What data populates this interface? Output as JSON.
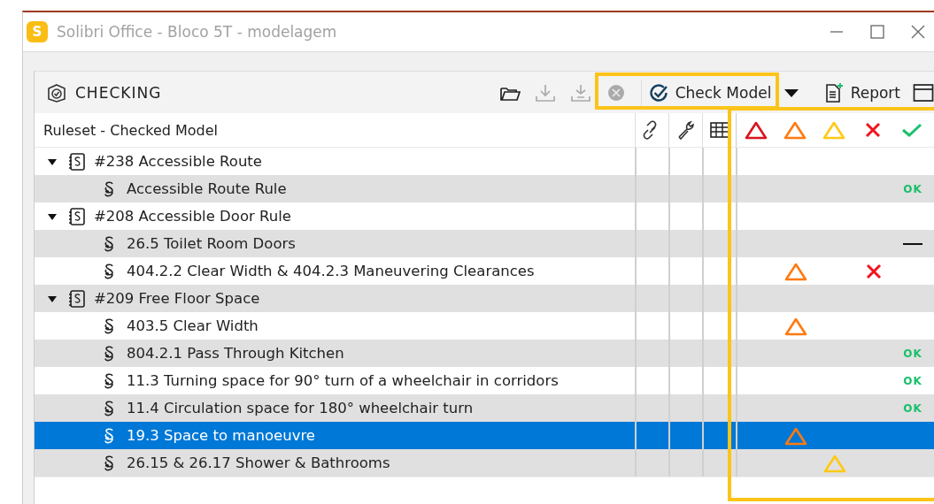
{
  "window": {
    "logo": "S",
    "title": "Solibri Office - Bloco 5T - modelagem"
  },
  "panel": {
    "title": "CHECKING",
    "tools": [
      {
        "kind": "open",
        "disabled": false
      },
      {
        "kind": "download",
        "disabled": true
      },
      {
        "kind": "download-all",
        "disabled": true
      },
      {
        "kind": "cancel",
        "disabled": true
      }
    ],
    "check_button": "Check Model",
    "report_button": "Report"
  },
  "table": {
    "column_title": "Ruleset - Checked Model",
    "rows": [
      {
        "kind": "ruleset",
        "label": "#238 Accessible Route",
        "expanded": true,
        "selected": false,
        "children": [
          {
            "kind": "rule",
            "label": "Accessible Route Rule",
            "selected": false,
            "results": [
              {
                "kind": "passed",
                "text": "OK"
              }
            ]
          }
        ]
      },
      {
        "kind": "ruleset",
        "label": "#208 Accessible Door Rule",
        "expanded": true,
        "selected": false,
        "children": [
          {
            "kind": "rule",
            "label": "26.5 Toilet Room Doors",
            "selected": false,
            "results": [
              {
                "kind": "not-checked"
              }
            ]
          },
          {
            "kind": "rule",
            "label": "404.2.2 Clear Width & 404.2.3 Maneuvering Clearances",
            "selected": false,
            "results": [
              {
                "kind": "moderate"
              },
              {
                "kind": "rejected"
              }
            ]
          }
        ]
      },
      {
        "kind": "ruleset",
        "label": "#209 Free Floor Space",
        "expanded": true,
        "selected": false,
        "children": [
          {
            "kind": "rule",
            "label": "403.5 Clear Width",
            "selected": false,
            "results": [
              {
                "kind": "moderate"
              }
            ]
          },
          {
            "kind": "rule",
            "label": "804.2.1 Pass Through Kitchen",
            "selected": false,
            "results": [
              {
                "kind": "passed",
                "text": "OK"
              }
            ]
          },
          {
            "kind": "rule",
            "label": "11.3 Turning space for 90° turn of a wheelchair in corridors",
            "selected": false,
            "results": [
              {
                "kind": "passed",
                "text": "OK"
              }
            ]
          },
          {
            "kind": "rule",
            "label": "11.4 Circulation space for 180° wheelchair turn",
            "selected": false,
            "results": [
              {
                "kind": "passed",
                "text": "OK"
              }
            ]
          },
          {
            "kind": "rule",
            "label": "19.3 Space to manoeuvre",
            "selected": true,
            "results": [
              {
                "kind": "moderate"
              }
            ]
          },
          {
            "kind": "rule",
            "label": "26.15 & 26.17 Shower & Bathrooms",
            "selected": false,
            "results": [
              {
                "kind": "low"
              }
            ]
          }
        ]
      }
    ]
  }
}
